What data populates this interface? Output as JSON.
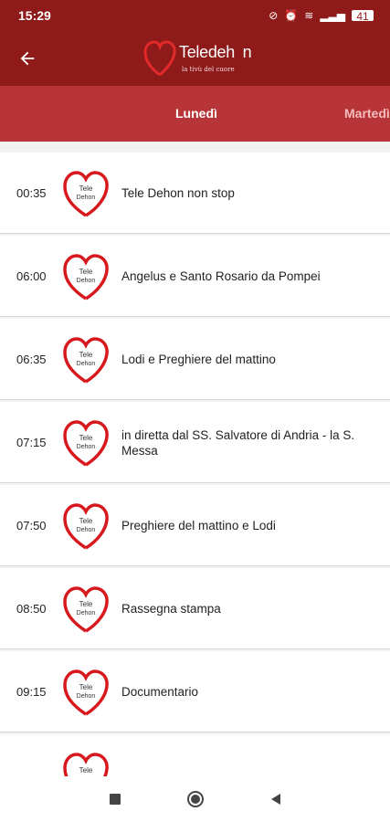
{
  "status": {
    "time": "15:29",
    "battery": "41"
  },
  "header": {
    "logo_text": "Teledeh n",
    "logo_tagline": "la tivù del cuore"
  },
  "tabs": {
    "active": "Lunedì",
    "next": "Martedì"
  },
  "schedule": [
    {
      "time": "00:35",
      "title": "Tele Dehon non stop"
    },
    {
      "time": "06:00",
      "title": "Angelus e Santo Rosario da Pompei"
    },
    {
      "time": "06:35",
      "title": "Lodi e Preghiere del mattino"
    },
    {
      "time": "07:15",
      "title": "in diretta dal SS. Salvatore di Andria - la S. Messa"
    },
    {
      "time": "07:50",
      "title": "Preghiere del mattino e Lodi"
    },
    {
      "time": "08:50",
      "title": "Rassegna stampa"
    },
    {
      "time": "09:15",
      "title": "Documentario"
    },
    {
      "time": "",
      "title": ""
    }
  ],
  "logo_heart_text": {
    "line1": "Tele",
    "line2": "Dehon"
  },
  "colors": {
    "primary": "#8e1a1a",
    "tabs": "#b73538",
    "heart": "#d7191e"
  },
  "icons": {
    "back": "arrow-left-icon",
    "recents": "square-icon",
    "home": "circle-icon",
    "back_nav": "triangle-left-icon"
  }
}
